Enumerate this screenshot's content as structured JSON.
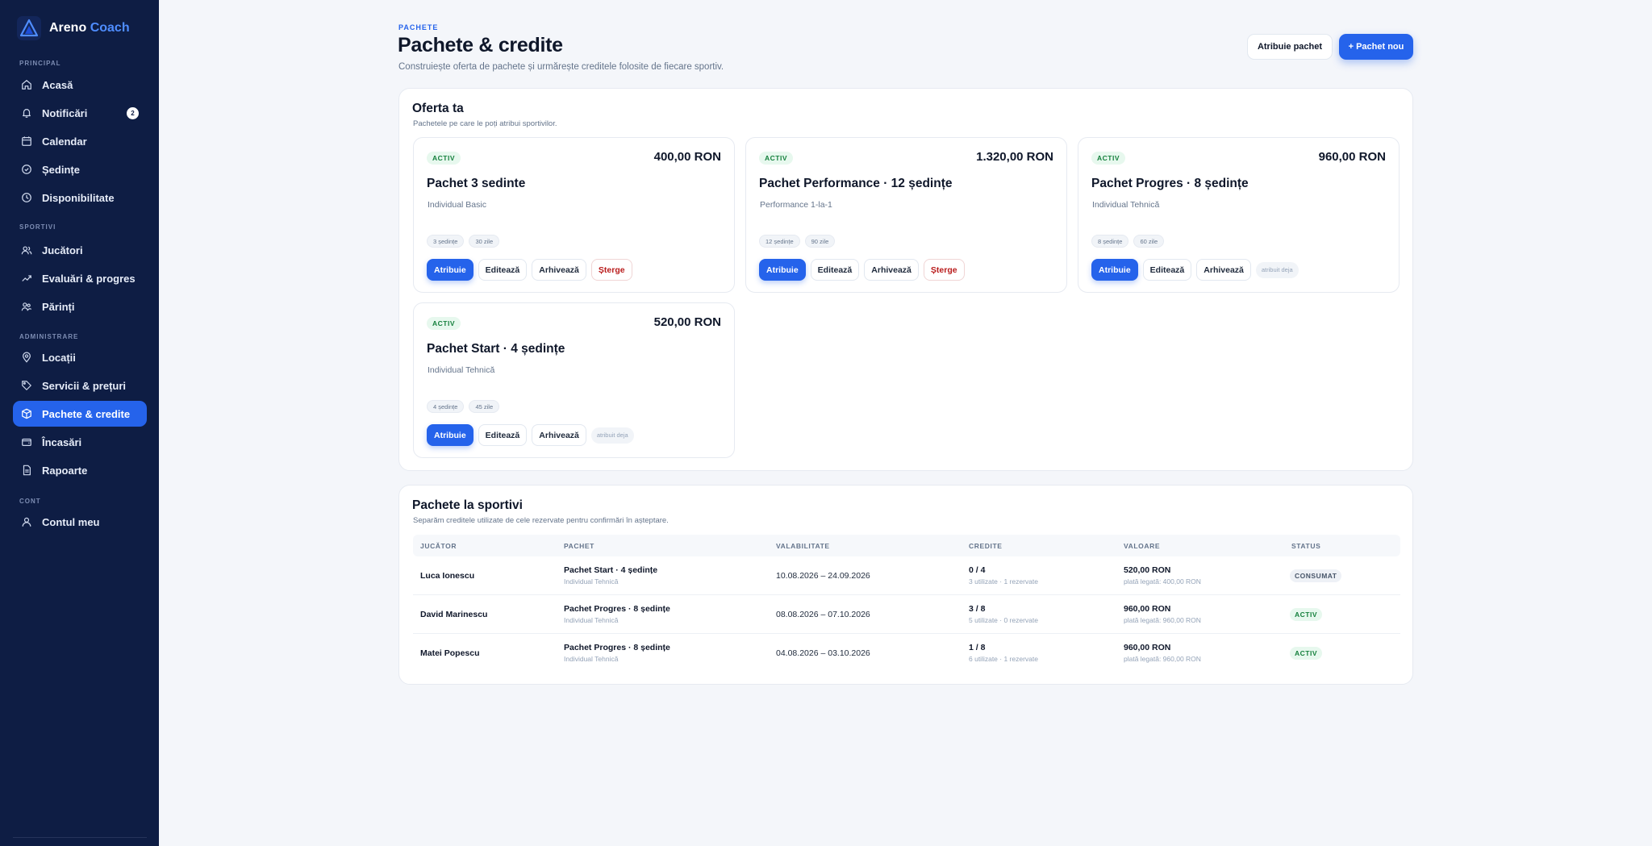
{
  "brand": {
    "name": "Areno",
    "accent": "Coach"
  },
  "sidebar": {
    "sections": [
      {
        "label": "PRINCIPAL"
      },
      {
        "label": "SPORTIVI"
      },
      {
        "label": "ADMINISTRARE"
      },
      {
        "label": "CONT"
      }
    ],
    "items": [
      {
        "label": "Acasă",
        "icon": "home-icon"
      },
      {
        "label": "Notificări",
        "icon": "bell-icon",
        "badge": "2"
      },
      {
        "label": "Calendar",
        "icon": "calendar-icon"
      },
      {
        "label": "Ședințe",
        "icon": "clock-check-icon"
      },
      {
        "label": "Disponibilitate",
        "icon": "clock-icon"
      },
      {
        "label": "Jucători",
        "icon": "users-icon"
      },
      {
        "label": "Evaluări & progres",
        "icon": "trend-up-icon"
      },
      {
        "label": "Părinți",
        "icon": "parents-icon"
      },
      {
        "label": "Locații",
        "icon": "location-pin-icon"
      },
      {
        "label": "Servicii & prețuri",
        "icon": "tag-icon"
      },
      {
        "label": "Pachete & credite",
        "icon": "package-icon",
        "active": true
      },
      {
        "label": "Încasări",
        "icon": "wallet-icon"
      },
      {
        "label": "Rapoarte",
        "icon": "document-icon"
      },
      {
        "label": "Contul meu",
        "icon": "user-icon"
      }
    ]
  },
  "header": {
    "eyebrow": "PACHETE",
    "title": "Pachete & credite",
    "subtitle": "Construiește oferta de pachete și urmărește creditele folosite de fiecare sportiv.",
    "assign_button": "Atribuie pachet",
    "new_button": "+ Pachet nou"
  },
  "offer": {
    "title": "Oferta ta",
    "subtitle": "Pachetele pe care le poți atribui sportivilor.",
    "cards": [
      {
        "status": "ACTIV",
        "price": "400,00 RON",
        "name": "Pachet 3 sedinte",
        "type": "Individual Basic",
        "tags": [
          "3 ședințe",
          "30 zile"
        ],
        "actions": {
          "assign": "Atribuie",
          "edit": "Editează",
          "archive": "Arhivează",
          "delete": "Șterge"
        }
      },
      {
        "status": "ACTIV",
        "price": "1.320,00 RON",
        "name": "Pachet Performance · 12 ședințe",
        "type": "Performance 1-la-1",
        "tags": [
          "12 ședințe",
          "90 zile"
        ],
        "actions": {
          "assign": "Atribuie",
          "edit": "Editează",
          "archive": "Arhivează",
          "delete": "Șterge"
        }
      },
      {
        "status": "ACTIV",
        "price": "960,00 RON",
        "name": "Pachet Progres · 8 ședințe",
        "type": "Individual Tehnică",
        "tags": [
          "8 ședințe",
          "60 zile"
        ],
        "actions": {
          "assign": "Atribuie",
          "edit": "Editează",
          "archive": "Arhivează",
          "note": "atribuit deja"
        }
      },
      {
        "status": "ACTIV",
        "price": "520,00 RON",
        "name": "Pachet Start · 4 ședințe",
        "type": "Individual Tehnică",
        "tags": [
          "4 ședințe",
          "45 zile"
        ],
        "actions": {
          "assign": "Atribuie",
          "edit": "Editează",
          "archive": "Arhivează",
          "note": "atribuit deja"
        }
      }
    ]
  },
  "players": {
    "title": "Pachete la sportivi",
    "subtitle": "Separăm creditele utilizate de cele rezervate pentru confirmări în așteptare.",
    "columns": [
      "JUCĂTOR",
      "PACHET",
      "VALABILITATE",
      "CREDITE",
      "VALOARE",
      "STATUS"
    ],
    "rows": [
      {
        "player": "Luca Ionescu",
        "package": "Pachet Start · 4 ședințe",
        "package_type": "Individual Tehnică",
        "validity": "10.08.2026 – 24.09.2026",
        "credits": "0 / 4",
        "credits_detail": "3 utilizate · 1 rezervate",
        "value": "520,00 RON",
        "value_detail": "plată legată: 400,00 RON",
        "status": "CONSUMAT"
      },
      {
        "player": "David Marinescu",
        "package": "Pachet Progres · 8 ședințe",
        "package_type": "Individual Tehnică",
        "validity": "08.08.2026 – 07.10.2026",
        "credits": "3 / 8",
        "credits_detail": "5 utilizate · 0 rezervate",
        "value": "960,00 RON",
        "value_detail": "plată legată: 960,00 RON",
        "status": "ACTIV"
      },
      {
        "player": "Matei Popescu",
        "package": "Pachet Progres · 8 ședințe",
        "package_type": "Individual Tehnică",
        "validity": "04.08.2026 – 03.10.2026",
        "credits": "1 / 8",
        "credits_detail": "6 utilizate · 1 rezervate",
        "value": "960,00 RON",
        "value_detail": "plată legată: 960,00 RON",
        "status": "ACTIV"
      }
    ]
  },
  "colors": {
    "sidebar_bg": "#0e1d44",
    "accent": "#2563eb",
    "active_status": "#15803d",
    "danger": "#b91c1c",
    "page_bg": "#f4f6fa"
  }
}
